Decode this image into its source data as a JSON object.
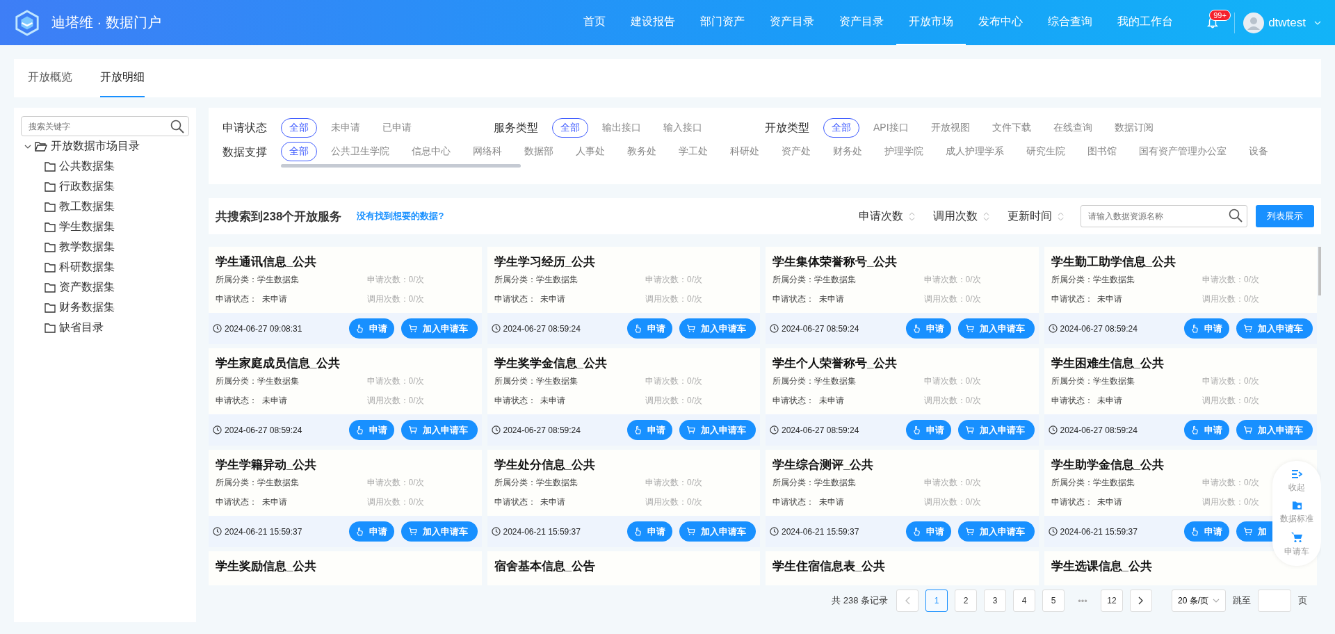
{
  "header": {
    "logo_title": "迪塔维 · 数据门户",
    "nav": [
      {
        "label": "首页",
        "selected": false
      },
      {
        "label": "建设报告",
        "selected": false
      },
      {
        "label": "部门资产",
        "selected": false
      },
      {
        "label": "资产目录",
        "selected": false
      },
      {
        "label": "资产目录",
        "selected": false
      },
      {
        "label": "开放市场",
        "selected": true
      },
      {
        "label": "发布中心",
        "selected": false
      },
      {
        "label": "综合查询",
        "selected": false
      },
      {
        "label": "我的工作台",
        "selected": false
      }
    ],
    "notification_badge": "99+",
    "username": "dtwtest"
  },
  "tabs": [
    {
      "label": "开放概览",
      "selected": false
    },
    {
      "label": "开放明细",
      "selected": true
    }
  ],
  "sidebar": {
    "search": {
      "placeholder": "搜索关键字"
    },
    "tree": [
      {
        "label": "开放数据市场目录",
        "expanded": true,
        "children": [
          {
            "label": "公共数据集"
          },
          {
            "label": "行政数据集"
          },
          {
            "label": "教工数据集"
          },
          {
            "label": "学生数据集"
          },
          {
            "label": "教学数据集"
          },
          {
            "label": "科研数据集"
          },
          {
            "label": "资产数据集"
          },
          {
            "label": "财务数据集"
          },
          {
            "label": "缺省目录"
          }
        ]
      }
    ]
  },
  "filters": [
    {
      "label": "申请状态",
      "options": [
        {
          "label": "全部",
          "selected": true
        },
        {
          "label": "未申请",
          "selected": false
        },
        {
          "label": "已申请",
          "selected": false
        }
      ]
    },
    {
      "label": "服务类型",
      "options": [
        {
          "label": "全部",
          "selected": true
        },
        {
          "label": "输出接口",
          "selected": false
        },
        {
          "label": "输入接口",
          "selected": false
        }
      ]
    },
    {
      "label": "开放类型",
      "options": [
        {
          "label": "全部",
          "selected": true
        },
        {
          "label": "API接口",
          "selected": false
        },
        {
          "label": "开放视图",
          "selected": false
        },
        {
          "label": "文件下载",
          "selected": false
        },
        {
          "label": "在线查询",
          "selected": false
        },
        {
          "label": "数据订阅",
          "selected": false
        }
      ]
    },
    {
      "label": "数据支撑",
      "options": [
        {
          "label": "全部",
          "selected": true
        },
        {
          "label": "公共卫生学院",
          "selected": false
        },
        {
          "label": "信息中心",
          "selected": false
        },
        {
          "label": "网络科",
          "selected": false
        },
        {
          "label": "数据部",
          "selected": false
        },
        {
          "label": "人事处",
          "selected": false
        },
        {
          "label": "教务处",
          "selected": false
        },
        {
          "label": "学工处",
          "selected": false
        },
        {
          "label": "科研处",
          "selected": false
        },
        {
          "label": "资产处",
          "selected": false
        },
        {
          "label": "财务处",
          "selected": false
        },
        {
          "label": "护理学院",
          "selected": false
        },
        {
          "label": "成人护理学系",
          "selected": false
        },
        {
          "label": "研究生院",
          "selected": false
        },
        {
          "label": "图书馆",
          "selected": false
        },
        {
          "label": "国有资产管理办公室",
          "selected": false
        },
        {
          "label": "设备",
          "selected": false
        }
      ]
    }
  ],
  "results": {
    "summary": "共搜索到238个开放服务",
    "help_link": "没有找到想要的数据?",
    "sorts": [
      "申请次数",
      "调用次数",
      "更新时间"
    ],
    "search": {
      "placeholder": "请输入数据资源名称"
    },
    "view_button": "列表展示"
  },
  "cards": [
    {
      "title": "学生通讯信息_公共",
      "category": "所属分类：学生数据集",
      "apply_count": "申请次数：0/次",
      "status": "申请状态：  未申请",
      "call_count": "调用次数：0/次",
      "time": "2024-06-27 09:08:31",
      "apply_button": "申请",
      "cart_button": "加入申请车"
    },
    {
      "title": "学生学习经历_公共",
      "category": "所属分类：学生数据集",
      "apply_count": "申请次数：0/次",
      "status": "申请状态：  未申请",
      "call_count": "调用次数：0/次",
      "time": "2024-06-27 08:59:24",
      "apply_button": "申请",
      "cart_button": "加入申请车"
    },
    {
      "title": "学生集体荣誉称号_公共",
      "category": "所属分类：学生数据集",
      "apply_count": "申请次数：0/次",
      "status": "申请状态：  未申请",
      "call_count": "调用次数：0/次",
      "time": "2024-06-27 08:59:24",
      "apply_button": "申请",
      "cart_button": "加入申请车"
    },
    {
      "title": "学生勤工助学信息_公共",
      "category": "所属分类：学生数据集",
      "apply_count": "申请次数：0/次",
      "status": "申请状态：  未申请",
      "call_count": "调用次数：0/次",
      "time": "2024-06-27 08:59:24",
      "apply_button": "申请",
      "cart_button": "加入申请车"
    },
    {
      "title": "学生家庭成员信息_公共",
      "category": "所属分类：学生数据集",
      "apply_count": "申请次数：0/次",
      "status": "申请状态：  未申请",
      "call_count": "调用次数：0/次",
      "time": "2024-06-27 08:59:24",
      "apply_button": "申请",
      "cart_button": "加入申请车"
    },
    {
      "title": "学生奖学金信息_公共",
      "category": "所属分类：学生数据集",
      "apply_count": "申请次数：0/次",
      "status": "申请状态：  未申请",
      "call_count": "调用次数：0/次",
      "time": "2024-06-27 08:59:24",
      "apply_button": "申请",
      "cart_button": "加入申请车"
    },
    {
      "title": "学生个人荣誉称号_公共",
      "category": "所属分类：学生数据集",
      "apply_count": "申请次数：0/次",
      "status": "申请状态：  未申请",
      "call_count": "调用次数：0/次",
      "time": "2024-06-27 08:59:24",
      "apply_button": "申请",
      "cart_button": "加入申请车"
    },
    {
      "title": "学生困难生信息_公共",
      "category": "所属分类：学生数据集",
      "apply_count": "申请次数：0/次",
      "status": "申请状态：  未申请",
      "call_count": "调用次数：0/次",
      "time": "2024-06-27 08:59:24",
      "apply_button": "申请",
      "cart_button": "加入申请车"
    },
    {
      "title": "学生学籍异动_公共",
      "category": "所属分类：学生数据集",
      "apply_count": "申请次数：0/次",
      "status": "申请状态：  未申请",
      "call_count": "调用次数：0/次",
      "time": "2024-06-21 15:59:37",
      "apply_button": "申请",
      "cart_button": "加入申请车"
    },
    {
      "title": "学生处分信息_公共",
      "category": "所属分类：学生数据集",
      "apply_count": "申请次数：0/次",
      "status": "申请状态：  未申请",
      "call_count": "调用次数：0/次",
      "time": "2024-06-21 15:59:37",
      "apply_button": "申请",
      "cart_button": "加入申请车"
    },
    {
      "title": "学生综合测评_公共",
      "category": "所属分类：学生数据集",
      "apply_count": "申请次数：0/次",
      "status": "申请状态：  未申请",
      "call_count": "调用次数：0/次",
      "time": "2024-06-21 15:59:37",
      "apply_button": "申请",
      "cart_button": "加入申请车"
    },
    {
      "title": "学生助学金信息_公共",
      "category": "所属分类：学生数据集",
      "apply_count": "申请次数：0/次",
      "status": "申请状态：  未申请",
      "call_count": "调用次数：0/次",
      "time": "2024-06-21 15:59:37",
      "apply_button": "申请",
      "cart_button": "加"
    },
    {
      "title": "学生奖励信息_公共"
    },
    {
      "title": "宿舍基本信息_公告"
    },
    {
      "title": "学生住宿信息表_公共"
    },
    {
      "title": "学生选课信息_公共"
    }
  ],
  "pagination": {
    "total": "共 238 条记录",
    "pages": [
      {
        "kind": "page",
        "label": "1",
        "selected": true
      },
      {
        "kind": "page",
        "label": "2",
        "selected": false
      },
      {
        "kind": "page",
        "label": "3",
        "selected": false
      },
      {
        "kind": "page",
        "label": "4",
        "selected": false
      },
      {
        "kind": "page",
        "label": "5",
        "selected": false
      },
      {
        "kind": "ellipsis",
        "label": "•••"
      },
      {
        "kind": "page",
        "label": "12",
        "selected": false
      }
    ],
    "page_size": "20 条/页",
    "jump_label": "跳至",
    "page_unit": "页"
  },
  "float_panel": [
    {
      "kind": "collapse",
      "label": "收起"
    },
    {
      "kind": "standard",
      "label": "数据标准"
    },
    {
      "kind": "cart",
      "label": "申请车"
    }
  ]
}
